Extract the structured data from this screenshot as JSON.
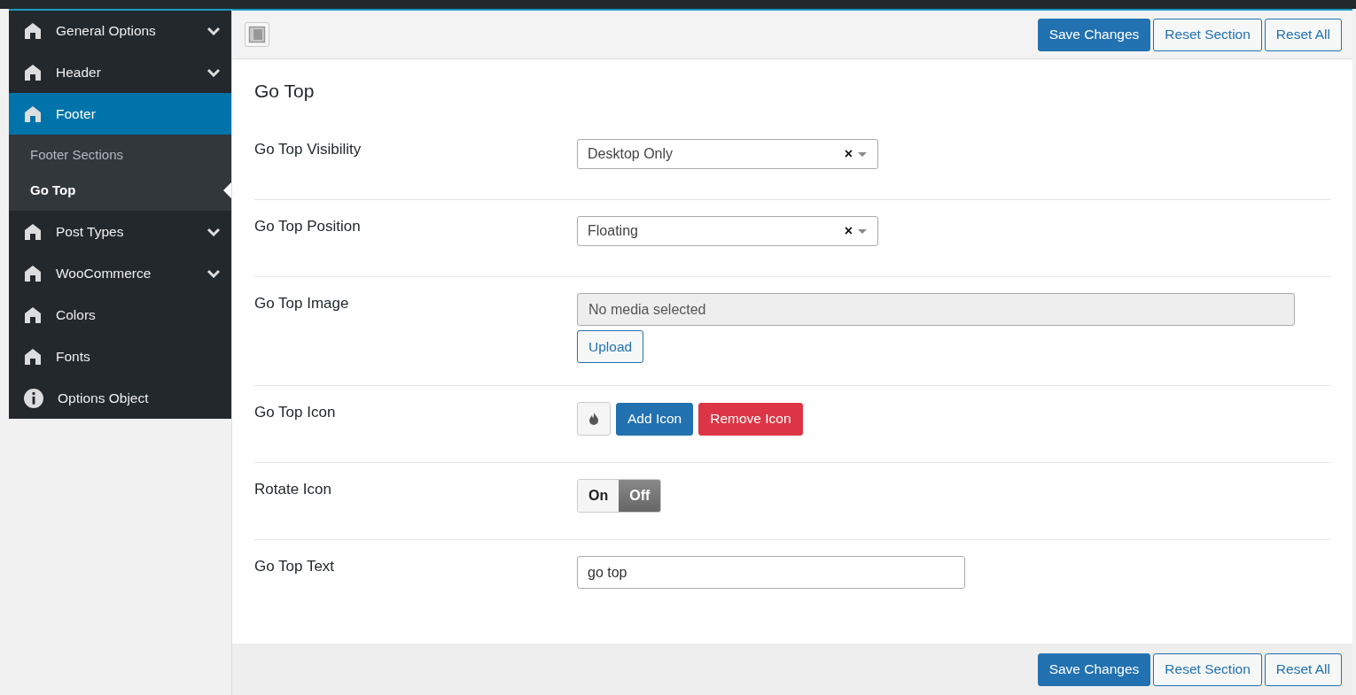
{
  "sidebar": {
    "items": [
      {
        "label": "General Options",
        "kind": "section",
        "expanded": false,
        "selected": false
      },
      {
        "label": "Header",
        "kind": "section",
        "expanded": false,
        "selected": false
      },
      {
        "label": "Footer",
        "kind": "section",
        "expanded": true,
        "selected": true,
        "children": [
          {
            "label": "Footer Sections",
            "selected": false
          },
          {
            "label": "Go Top",
            "selected": true
          }
        ]
      },
      {
        "label": "Post Types",
        "kind": "section",
        "expanded": false,
        "selected": false
      },
      {
        "label": "WooCommerce",
        "kind": "section",
        "expanded": false,
        "selected": false
      },
      {
        "label": "Colors",
        "kind": "section",
        "selected": false
      },
      {
        "label": "Fonts",
        "kind": "section",
        "selected": false
      },
      {
        "label": "Options Object",
        "kind": "object",
        "selected": false
      }
    ]
  },
  "toolbar": {
    "buttons": [
      {
        "label": "Save Changes",
        "kind": "primary"
      },
      {
        "label": "Reset Section",
        "kind": "secondary"
      },
      {
        "label": "Reset All",
        "kind": "secondary"
      }
    ]
  },
  "section": {
    "title": "Go Top",
    "fields": [
      {
        "label": "Go Top Visibility",
        "kind": "select",
        "value": "Desktop Only",
        "clear": "×"
      },
      {
        "label": "Go Top Position",
        "kind": "select",
        "value": "Floating",
        "clear": "×"
      },
      {
        "label": "Go Top Image",
        "kind": "media",
        "placeholder": "No media selected",
        "button": "Upload"
      },
      {
        "label": "Go Top Icon",
        "kind": "icon",
        "add": "Add Icon",
        "remove": "Remove Icon"
      },
      {
        "label": "Rotate Icon",
        "kind": "switch",
        "on_label": "On",
        "off_label": "Off",
        "on": false
      },
      {
        "label": "Go Top Text",
        "kind": "text",
        "value": "go top"
      }
    ]
  },
  "footer": {
    "buttons": [
      {
        "label": "Save Changes",
        "kind": "primary"
      },
      {
        "label": "Reset Section",
        "kind": "secondary"
      },
      {
        "label": "Reset All",
        "kind": "secondary"
      }
    ]
  }
}
